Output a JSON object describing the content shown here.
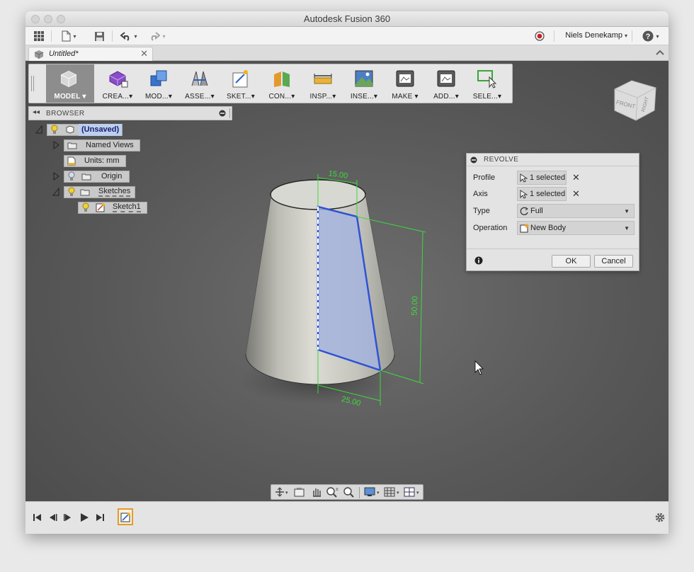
{
  "window": {
    "title": "Autodesk Fusion 360"
  },
  "appbar": {
    "user_name": "Niels Denekamp"
  },
  "document": {
    "tab_name": "Untitled*"
  },
  "toolbar": {
    "items": [
      {
        "label": "MODEL ▾"
      },
      {
        "label": "CREA...▾"
      },
      {
        "label": "MOD...▾"
      },
      {
        "label": "ASSE...▾"
      },
      {
        "label": "SKET...▾"
      },
      {
        "label": "CON...▾"
      },
      {
        "label": "INSP...▾"
      },
      {
        "label": "INSE...▾"
      },
      {
        "label": "MAKE ▾"
      },
      {
        "label": "ADD...▾"
      },
      {
        "label": "SELE...▾"
      }
    ]
  },
  "viewcube": {
    "front": "FRONT",
    "right": "RIGHT"
  },
  "browser": {
    "title": "BROWSER",
    "items": [
      {
        "label": "(Unsaved)"
      },
      {
        "label": "Named Views"
      },
      {
        "label": "Units: mm"
      },
      {
        "label": "Origin"
      },
      {
        "label": "Sketches"
      },
      {
        "label": "Sketch1"
      }
    ]
  },
  "model": {
    "dimensions": {
      "top": "15.00",
      "height": "50.00",
      "bottom": "25.00"
    }
  },
  "revolve": {
    "title": "REVOLVE",
    "profile_label": "Profile",
    "profile_value": "1 selected",
    "axis_label": "Axis",
    "axis_value": "1 selected",
    "type_label": "Type",
    "type_value": "Full",
    "operation_label": "Operation",
    "operation_value": "New Body",
    "ok_label": "OK",
    "cancel_label": "Cancel"
  },
  "icons": {
    "grid": "grid-icon",
    "file": "file-icon",
    "save": "save-icon",
    "undo": "undo-icon",
    "redo": "redo-icon",
    "record": "record-icon",
    "help": "help-icon",
    "settings": "gear-icon"
  }
}
